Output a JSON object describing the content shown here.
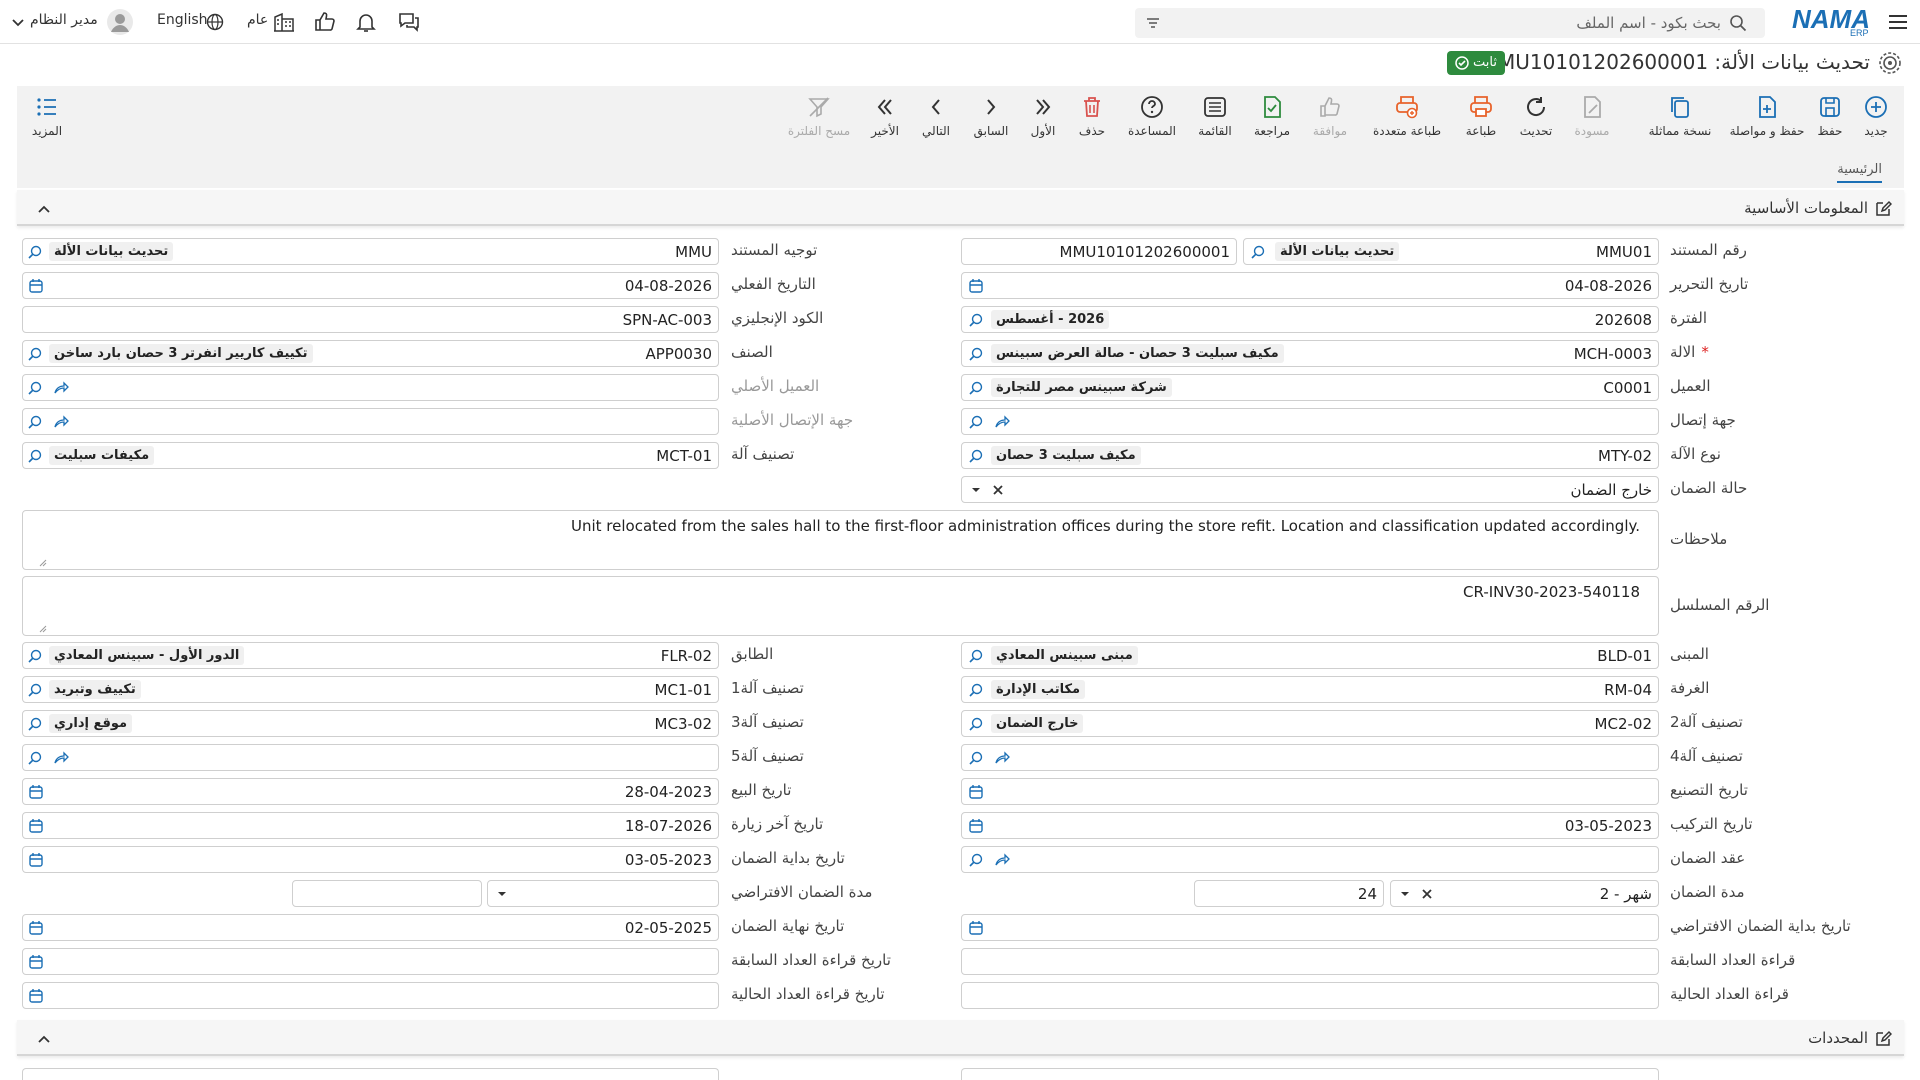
{
  "topbar": {
    "search_placeholder": "بحث بكود - اسم الملف",
    "user_name": "مدير النظام",
    "language": "English",
    "scope": "عام",
    "logo_text": "NAMA",
    "logo_sub": "ERP"
  },
  "header": {
    "title": "تحديث بيانات الألة: MMU10101202600001",
    "status": "ثابت"
  },
  "toolbar": {
    "new": "جديد",
    "save": "حفظ",
    "save_continue": "حفظ و مواصلة",
    "duplicate": "نسخة مماثلة",
    "draft": "مسودة",
    "refresh": "تحديث",
    "print": "طباعة",
    "multi_print": "طباعة متعددة",
    "approve": "موافقة",
    "review": "مراجعة",
    "list": "القائمة",
    "help": "المساعدة",
    "delete": "حذف",
    "first": "الأول",
    "previous": "السابق",
    "next": "التالي",
    "last": "الأخير",
    "clear_filter": "مسح الفلترة",
    "more": "المزيد"
  },
  "tabs": {
    "main": "الرئيسية"
  },
  "sections": {
    "basic": "المعلومات الأساسية",
    "determinants": "المحددات"
  },
  "labels": {
    "doc_no": "رقم المستند",
    "doc_dir": "توجيه المستند",
    "edit_date": "تاريخ التحرير",
    "actual_date": "التاريخ الفعلي",
    "period": "الفترة",
    "english_code": "الكود الإنجليزي",
    "machine": "الالة",
    "item": "الصنف",
    "customer": "العميل",
    "orig_customer": "العميل الأصلي",
    "contact": "جهة إتصال",
    "orig_contact": "جهة الإتصال الأصلية",
    "machine_type": "نوع الآلة",
    "machine_class": "تصنيف آلة",
    "warranty_status": "حالة الضمان",
    "notes": "ملاحظات",
    "serial": "الرقم المسلسل",
    "building": "المبنى",
    "floor": "الطابق",
    "room": "الغرفة",
    "class1": "تصنيف آلة1",
    "class2": "تصنيف آلة2",
    "class3": "تصنيف آلة3",
    "class4": "تصنيف آلة4",
    "class5": "تصنيف آلة5",
    "mfg_date": "تاريخ التصنيع",
    "sale_date": "تاريخ البيع",
    "install_date": "تاريخ التركيب",
    "last_visit": "تاريخ آخر زيارة",
    "warranty_contract": "عقد الضمان",
    "warranty_start": "تاريخ بداية الضمان",
    "warranty_period": "مدة الضمان",
    "default_warranty_period": "مدة الضمان الافتراضي",
    "default_warranty_start": "تاريخ بداية الضمان الافتراضي",
    "warranty_end": "تاريخ نهاية الضمان",
    "prev_meter": "قراءة العداد السابقة",
    "prev_meter_date": "تاريخ قراءة العداد السابقة",
    "curr_meter": "قراءة العداد الحالية",
    "curr_meter_date": "تاريخ قراءة العداد الحالية"
  },
  "values": {
    "doc_code": "MMU01",
    "doc_type_name": "تحديث بيانات الألة",
    "doc_number": "MMU10101202600001",
    "doc_dir_code": "MMU",
    "doc_dir_name": "تحديث بيانات الألة",
    "edit_date": "04-08-2026",
    "actual_date": "04-08-2026",
    "period_code": "202608",
    "period_name": "2026 - أغسطس",
    "english_code": "SPN-AC-003",
    "machine_code": "MCH-0003",
    "machine_name": "مكيف سبليت 3 حصان - صالة العرض سبينس",
    "item_code": "APP0030",
    "item_name": "تكييف كاريير انفرتر 3 حصان بارد ساخن",
    "customer_code": "C0001",
    "customer_name": "شركة سبينس مصر للتجارة",
    "machine_type_code": "MTY-02",
    "machine_type_name": "مكيف سبليت 3 حصان",
    "machine_class_code": "MCT-01",
    "machine_class_name": "مكيفات سبليت",
    "warranty_status": "خارج الضمان",
    "notes": "Unit relocated from the sales hall to the first-floor administration offices during the store refit. Location and classification updated accordingly.",
    "serial": "CR-INV30-2023-540118",
    "building_code": "BLD-01",
    "building_name": "مبنى سبينس المعادي",
    "floor_code": "FLR-02",
    "floor_name": "الدور الأول - سبينس المعادي",
    "room_code": "RM-04",
    "room_name": "مكاتب الإدارة",
    "class1_code": "MC1-01",
    "class1_name": "تكييف وتبريد",
    "class2_code": "MC2-02",
    "class2_name": "خارج الضمان",
    "class3_code": "MC3-02",
    "class3_name": "موقع إداري",
    "sale_date": "28-04-2023",
    "install_date": "03-05-2023",
    "last_visit": "18-07-2026",
    "warranty_start": "03-05-2023",
    "warranty_period_unit": "2 - شهر",
    "warranty_period_value": "24",
    "warranty_end": "02-05-2025"
  },
  "colors": {
    "accent": "#1b6fb5",
    "status": "#2e8b3e",
    "danger": "#d9534f",
    "print": "#e8632b"
  }
}
